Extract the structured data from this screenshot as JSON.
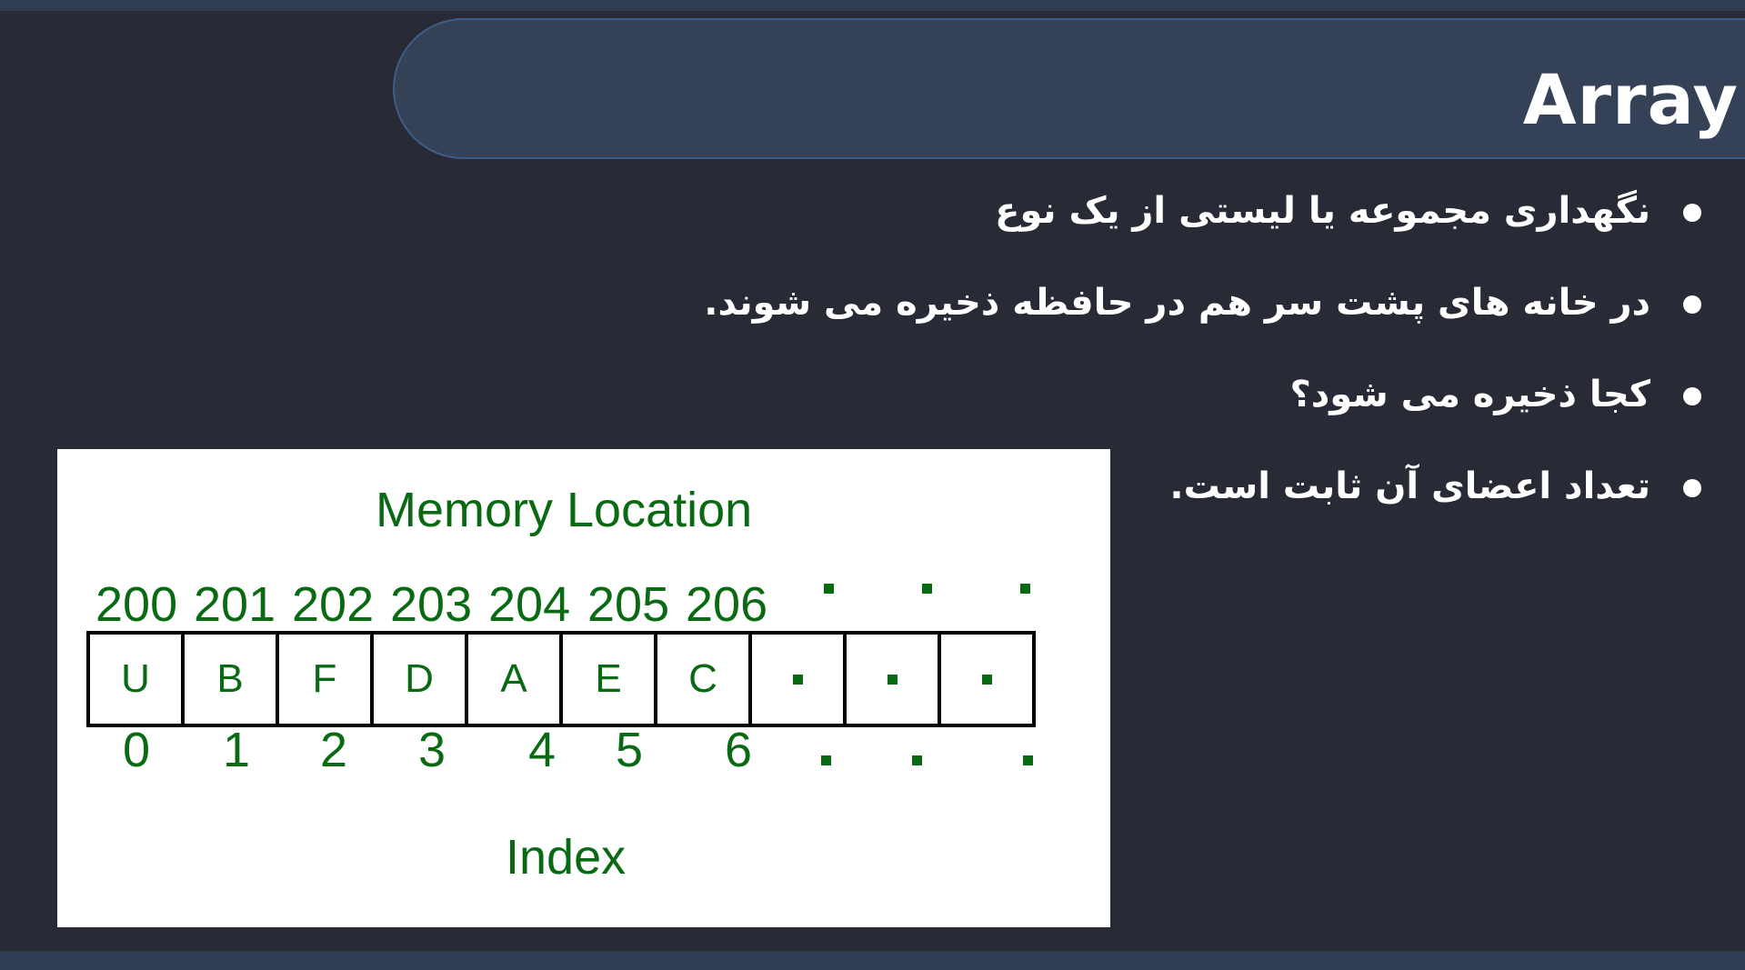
{
  "slide": {
    "title": "Array",
    "bullets": [
      "نگهداری مجموعه یا لیستی از یک نوع",
      "در خانه های پشت سر هم در حافظه ذخیره می شوند.",
      "کجا ذخیره می شود؟",
      "تعداد اعضای آن ثابت است."
    ]
  },
  "diagram": {
    "memory_title": "Memory Location",
    "addresses": [
      "200",
      "201",
      "202",
      "203",
      "204",
      "205",
      "206"
    ],
    "cells": [
      "U",
      "B",
      "F",
      "D",
      "A",
      "E",
      "C"
    ],
    "indexes": [
      "0",
      "1",
      "2",
      "3",
      "4",
      "5",
      "6"
    ],
    "index_title": "Index",
    "continuation_marker_count": 3
  },
  "colors": {
    "background": "#282a36",
    "banner": "#344157",
    "diagram_text": "#0a6a14"
  }
}
